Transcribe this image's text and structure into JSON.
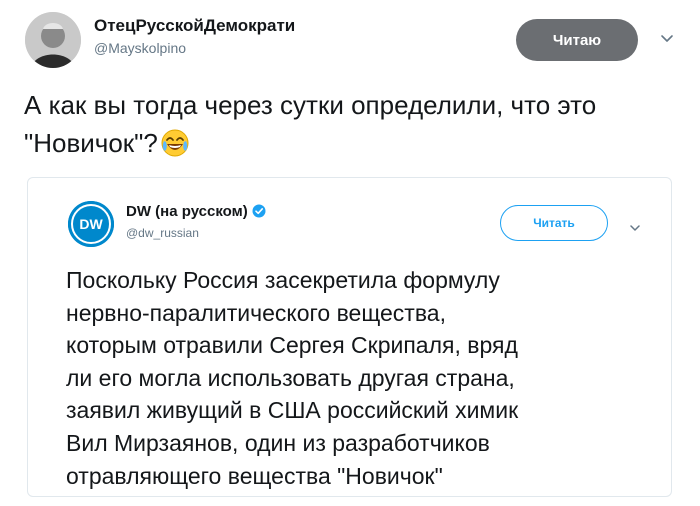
{
  "tweet": {
    "author_name": "ОтецРусскойДемократи",
    "author_handle": "@Mayskolpino",
    "follow_label": "Читаю",
    "text": "А как вы тогда через сутки определили, что это \"Новичок\"?",
    "emoji": "face-with-tears-of-joy"
  },
  "quoted_tweet": {
    "author_name": "DW (на русском)",
    "author_handle": "@dw_russian",
    "avatar_text": "DW",
    "follow_label": "Читать",
    "text_lines": [
      "Поскольку Россия засекретила формулу",
      "нервно-паралитического вещества,",
      "которым отравили Сергея Скрипаля, вряд",
      "ли его могла использовать другая страна,",
      "заявил живущий в США российский химик",
      "Вил Мирзаянов, один из разработчиков",
      "отравляющего вещества \"Новичок\""
    ]
  },
  "colors": {
    "primary_text": "#14171a",
    "secondary_text": "#657786",
    "follow_button_bg": "#6b6e72",
    "accent_blue": "#1da1f2",
    "dw_blue": "#0088cc",
    "border": "#e1e8ed"
  },
  "icons": [
    "chevron-down-icon",
    "verified-badge-icon",
    "laughing-emoji-icon"
  ]
}
